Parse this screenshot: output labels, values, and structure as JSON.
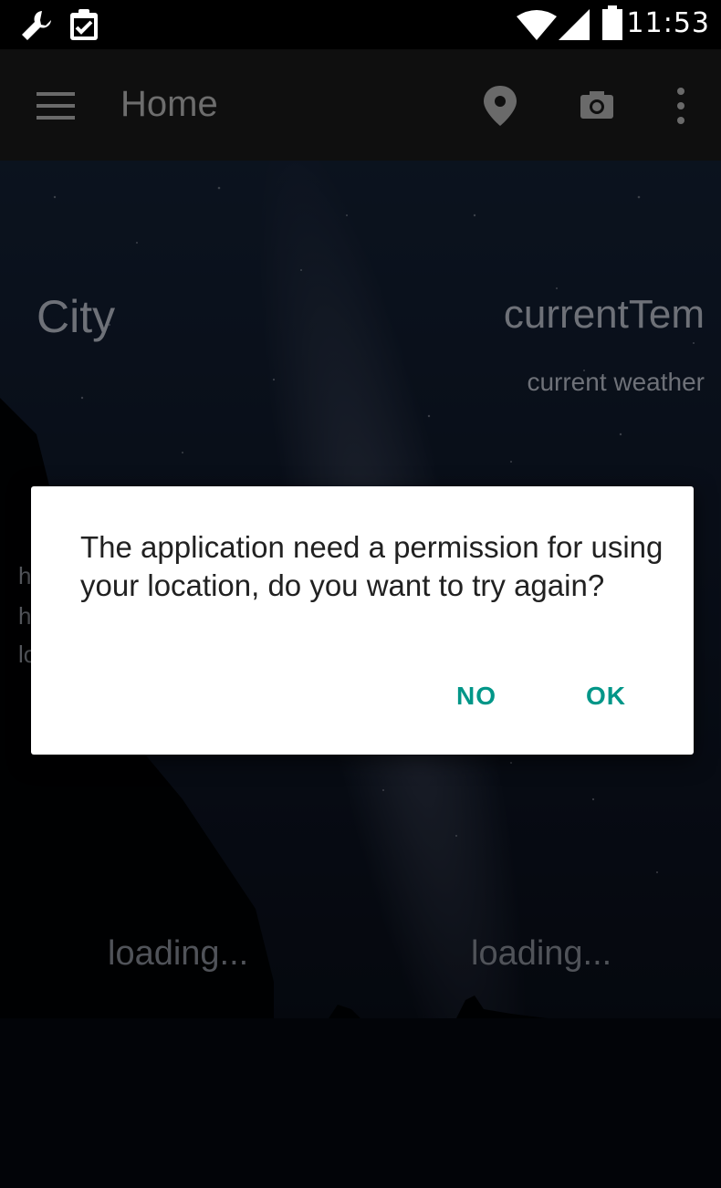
{
  "status_bar": {
    "time": "11:53",
    "icons": [
      "wrench-icon",
      "clipboard-check-icon",
      "wifi-icon",
      "signal-icon",
      "battery-icon"
    ]
  },
  "toolbar": {
    "title": "Home",
    "icons": [
      "menu-icon",
      "location-pin-icon",
      "camera-icon",
      "overflow-menu-icon"
    ]
  },
  "weather": {
    "city": "City",
    "current_temp": "currentTem",
    "current_weather": "current weather",
    "partial_lines": [
      "h",
      "h",
      "lo"
    ],
    "loading_left": "loading...",
    "loading_right": "loading..."
  },
  "dialog": {
    "message": "The application need a permission for using your location, do you want to try again?",
    "no_label": "NO",
    "ok_label": "OK"
  },
  "colors": {
    "accent": "#009688",
    "toolbar_bg": "#0f0f0f",
    "dialog_bg": "#ffffff"
  }
}
